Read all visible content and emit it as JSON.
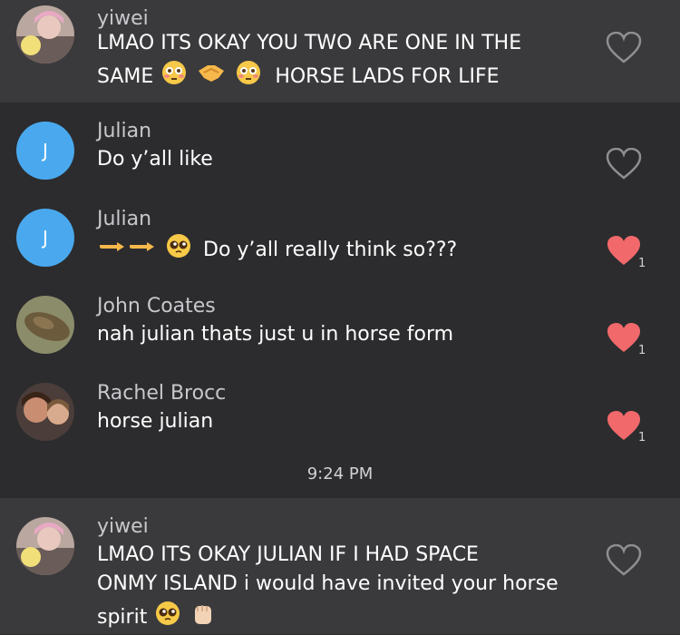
{
  "messages": [
    {
      "name": "yiwei",
      "lines": [
        "LMAO ITS OKAY YOU TWO ARE ONE IN THE",
        "SAME",
        "HORSE LADS FOR LIFE"
      ],
      "liked": false,
      "likes": ""
    },
    {
      "name": "Julian",
      "avatar_letter": "J",
      "lines": [
        "Do y’all like"
      ],
      "liked": false,
      "likes": ""
    },
    {
      "name": "Julian",
      "avatar_letter": "J",
      "lines": [
        "Do y’all really think so???"
      ],
      "liked": true,
      "likes": "1"
    },
    {
      "name": "John Coates",
      "lines": [
        "nah julian thats just u in horse form"
      ],
      "liked": true,
      "likes": "1"
    },
    {
      "name": "Rachel Brocc",
      "lines": [
        "horse julian"
      ],
      "liked": true,
      "likes": "1"
    },
    {
      "name": "yiwei",
      "lines": [
        "LMAO  ITS OKAY JULIAN IF I HAD SPACE",
        "ONMY ISLAND i would have invited your horse",
        "spirit"
      ],
      "liked": false,
      "likes": ""
    }
  ],
  "timestamp": "9:24 PM",
  "colors": {
    "background": "#2c2c2e",
    "highlight_block": "#3a3a3c",
    "heart_liked": "#f2696b",
    "heart_outline": "#8e8e93",
    "avatar_blue": "#4aa9ee"
  },
  "icons": {
    "heart": "heart-icon",
    "flushed_emoji": "flushed-face-emoji",
    "handshake_emoji": "handshake-emoji",
    "pointing_emoji": "pointing-right-emoji",
    "pleading_emoji": "pleading-face-emoji",
    "fist_emoji": "raised-fist-emoji"
  }
}
